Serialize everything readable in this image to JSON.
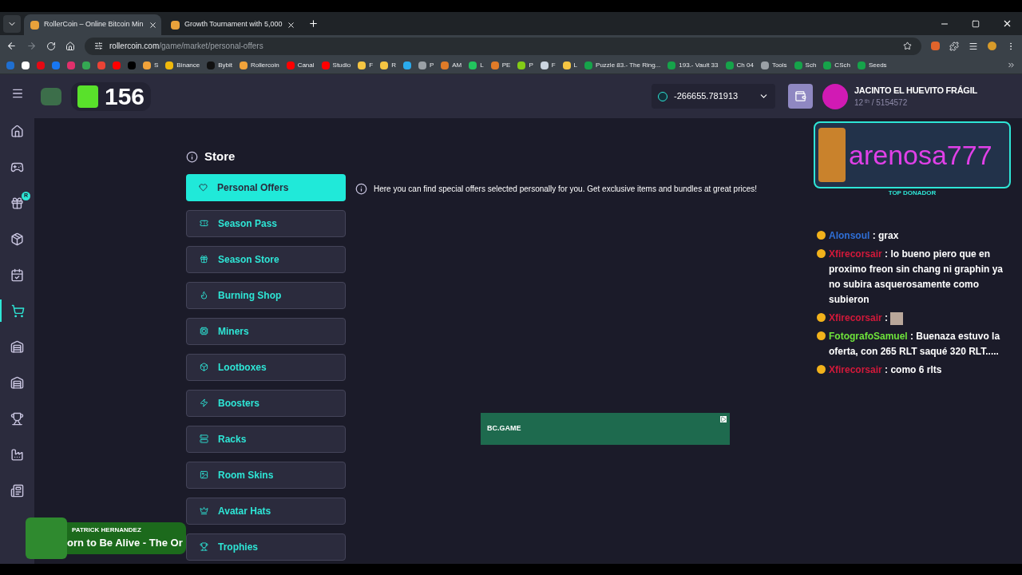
{
  "browser": {
    "tabs": [
      {
        "title": "RollerCoin – Online Bitcoin Min",
        "selected": true
      },
      {
        "title": "Growth Tournament with 5,000",
        "selected": false
      }
    ],
    "url_host": "rollercoin.com",
    "url_path": "/game/market/personal-offers",
    "bookmarks": [
      {
        "color": "#1f6fd1"
      },
      {
        "color": "#ffffff"
      },
      {
        "color": "#e50914"
      },
      {
        "color": "#1877f2"
      },
      {
        "color": "#e1306c"
      },
      {
        "color": "#34a853"
      },
      {
        "color": "#ea4335"
      },
      {
        "color": "#ff0000"
      },
      {
        "color": "#000000"
      },
      {
        "label": "S",
        "color": "#f2a33a"
      },
      {
        "label": "Binance",
        "color": "#f0b90b"
      },
      {
        "label": "Bybit",
        "color": "#111111"
      },
      {
        "label": "Rollercoin",
        "color": "#f2a33a"
      },
      {
        "label": "Canal",
        "color": "#ff0000"
      },
      {
        "label": "Studio",
        "color": "#ff0000"
      },
      {
        "label": "F",
        "color": "#f5c542"
      },
      {
        "label": "R",
        "color": "#f5c542"
      },
      {
        "color": "#2aabee"
      },
      {
        "label": "P",
        "color": "#9aa0a6"
      },
      {
        "label": "AM",
        "color": "#e07b28"
      },
      {
        "label": "L",
        "color": "#22c55e"
      },
      {
        "label": "PE",
        "color": "#e07b28"
      },
      {
        "label": "P",
        "color": "#84cc16"
      },
      {
        "label": "F",
        "color": "#cbd5e1"
      },
      {
        "label": "L",
        "color": "#f5c542"
      },
      {
        "label": "Puzzle 83.- The Ring...",
        "color": "#16a34a"
      },
      {
        "label": "193.- Vault 33",
        "color": "#16a34a"
      },
      {
        "label": "Ch 04",
        "color": "#16a34a"
      },
      {
        "label": "Tools",
        "color": "#9aa0a6"
      },
      {
        "label": "Sch",
        "color": "#16a34a"
      },
      {
        "label": "CSch",
        "color": "#16a34a"
      },
      {
        "label": "Seeds",
        "color": "#16a34a"
      }
    ]
  },
  "header": {
    "level": "156",
    "balance": "-266655.781913",
    "user_name": "JACINTO EL HUEVITO FRÁGIL",
    "rank": "12",
    "rank_suffix": "th",
    "rank_total": "/ 5154572"
  },
  "sidebar": {
    "items": [
      {
        "selected": false
      },
      {
        "selected": false
      },
      {
        "selected": false,
        "badge": "R"
      },
      {
        "selected": false
      },
      {
        "selected": false
      },
      {
        "selected": true
      },
      {
        "selected": false
      },
      {
        "selected": false
      },
      {
        "selected": false
      },
      {
        "selected": false
      },
      {
        "selected": false
      }
    ]
  },
  "store": {
    "title": "Store",
    "items": [
      {
        "label": "Personal Offers",
        "selected": true
      },
      {
        "label": "Season Pass",
        "selected": false
      },
      {
        "label": "Season Store",
        "selected": false
      },
      {
        "label": "Burning Shop",
        "selected": false
      },
      {
        "label": "Miners",
        "selected": false
      },
      {
        "label": "Lootboxes",
        "selected": false
      },
      {
        "label": "Boosters",
        "selected": false
      },
      {
        "label": "Racks",
        "selected": false
      },
      {
        "label": "Room Skins",
        "selected": false
      },
      {
        "label": "Avatar Hats",
        "selected": false
      },
      {
        "label": "Trophies",
        "selected": false
      }
    ],
    "info": "Here you can find special offers selected personally for you. Get exclusive items and bundles at great prices!"
  },
  "ad": {
    "brand": "BC.GAME"
  },
  "stream": {
    "donor_name": "arenosa777",
    "donor_caption": "TOP DONADOR",
    "chat": [
      {
        "user": "Alonsoul",
        "color": "#2f6fd6",
        "sep": ":",
        "text": "grax"
      },
      {
        "user": "Xfirecorsair",
        "color": "#d2193a",
        "sep": ":",
        "text": "lo bueno piero que en proximo freon sin chang ni graphin ya no subira asquerosamente como subieron"
      },
      {
        "user": "Xfirecorsair",
        "color": "#d2193a",
        "sep": ":",
        "kind": "image"
      },
      {
        "user": "FotografoSamuel",
        "color": "#6ee33b",
        "sep": ":",
        "text": "Buenaza estuvo la oferta, con 265 RLT saqué 320 RLT....."
      },
      {
        "user": "Xfirecorsair",
        "color": "#d2193a",
        "sep": ":",
        "text": "como 6 rlts"
      }
    ],
    "music": {
      "artist": "PATRICK HERNANDEZ",
      "title": "orn to Be Alive - The Or"
    }
  }
}
